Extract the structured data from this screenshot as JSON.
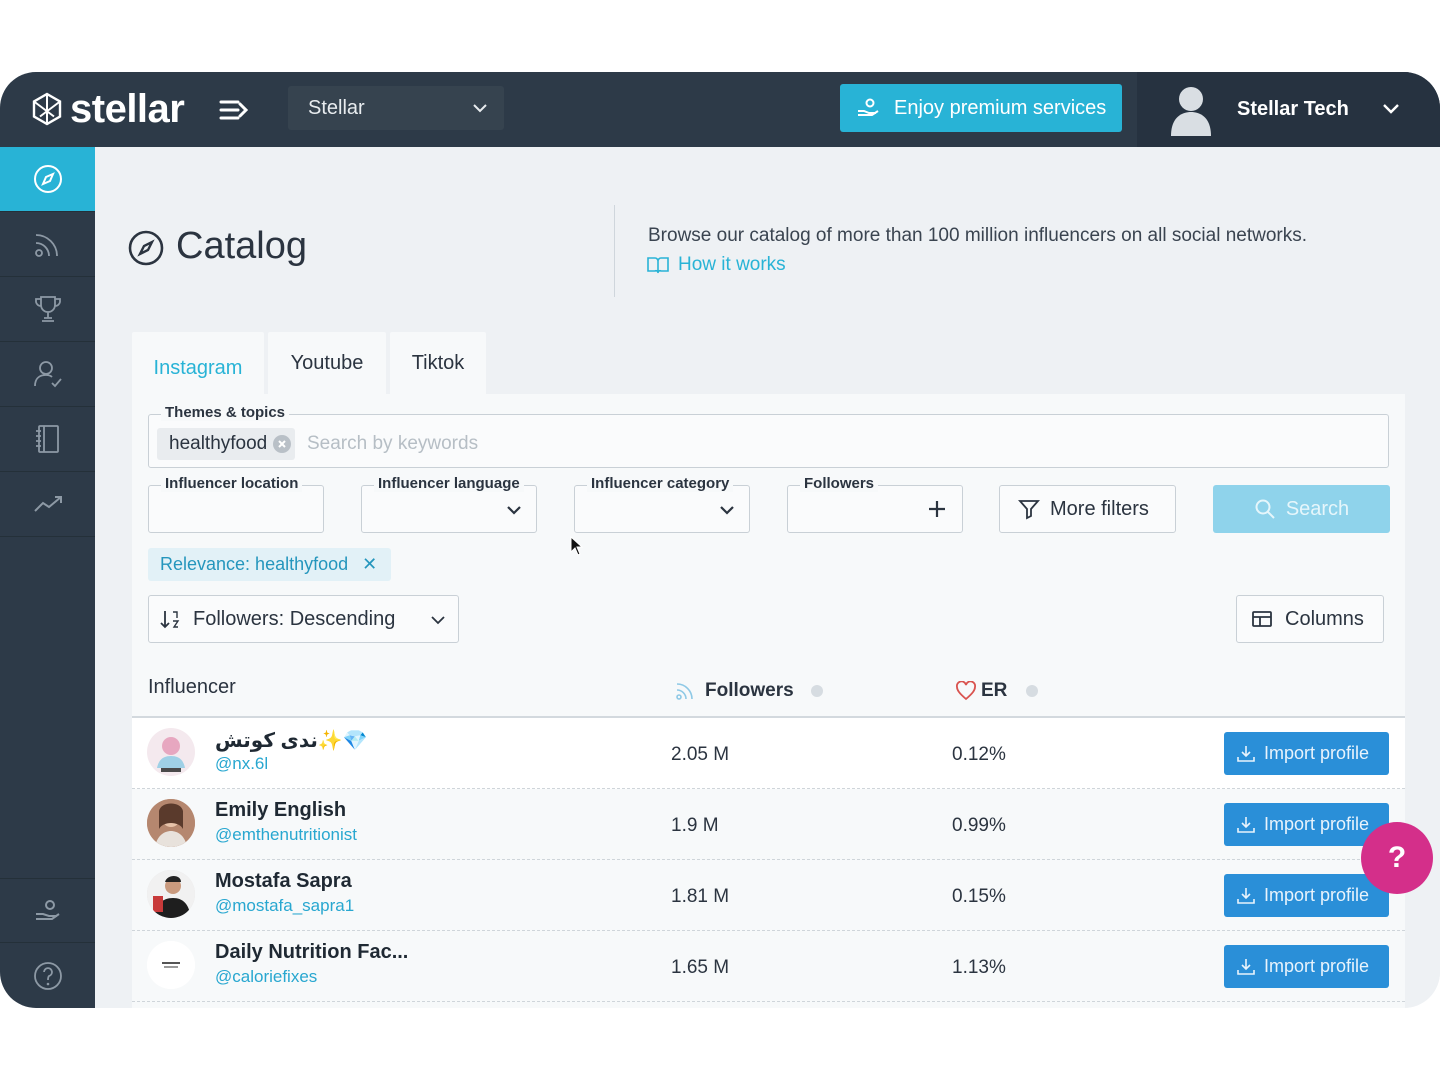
{
  "app": {
    "logo_text": "stellar"
  },
  "topbar": {
    "org_select": "Stellar",
    "premium_label": "Enjoy premium services",
    "user_name": "Stellar Tech"
  },
  "sidebar": {
    "items": [
      {
        "icon": "compass-icon",
        "active": true
      },
      {
        "icon": "rss-icon"
      },
      {
        "icon": "trophy-icon"
      },
      {
        "icon": "user-check-icon"
      },
      {
        "icon": "notebook-icon"
      },
      {
        "icon": "trend-icon"
      }
    ],
    "bottom": [
      {
        "icon": "hand-coins-icon"
      },
      {
        "icon": "help-circle-icon"
      }
    ]
  },
  "header": {
    "title": "Catalog",
    "description": "Browse our catalog of more than 100 million influencers on all social networks.",
    "how_it_works": "How it works"
  },
  "tabs": [
    "Instagram",
    "Youtube",
    "Tiktok"
  ],
  "filters": {
    "themes_label": "Themes & topics",
    "theme_chip": "healthyfood",
    "keywords_placeholder": "Search by keywords",
    "location_label": "Influencer location",
    "language_label": "Influencer language",
    "category_label": "Influencer category",
    "followers_label": "Followers",
    "more_filters": "More filters",
    "search": "Search"
  },
  "relevance_tag": "Relevance: healthyfood",
  "sort": "Followers: Descending",
  "columns_button": "Columns",
  "table": {
    "headers": {
      "influencer": "Influencer",
      "followers": "Followers",
      "er": "ER"
    },
    "rows": [
      {
        "name": "ندى كوتش✨💎",
        "handle": "@nx.6l",
        "followers": "2.05 M",
        "er": "0.12%",
        "action": "Import profile"
      },
      {
        "name": "Emily English",
        "handle": "@emthenutritionist",
        "followers": "1.9 M",
        "er": "0.99%",
        "action": "Import profile"
      },
      {
        "name": "Mostafa Sapra",
        "handle": "@mostafa_sapra1",
        "followers": "1.81 M",
        "er": "0.15%",
        "action": "Import profile"
      },
      {
        "name": "Daily Nutrition Fac...",
        "handle": "@caloriefixes",
        "followers": "1.65 M",
        "er": "1.13%",
        "action": "Import profile"
      }
    ]
  },
  "help_bubble": "?",
  "colors": {
    "brand": "#28b3d6",
    "sidebar": "#2d3a48",
    "import": "#2a8fd8",
    "help": "#d42f8a"
  }
}
